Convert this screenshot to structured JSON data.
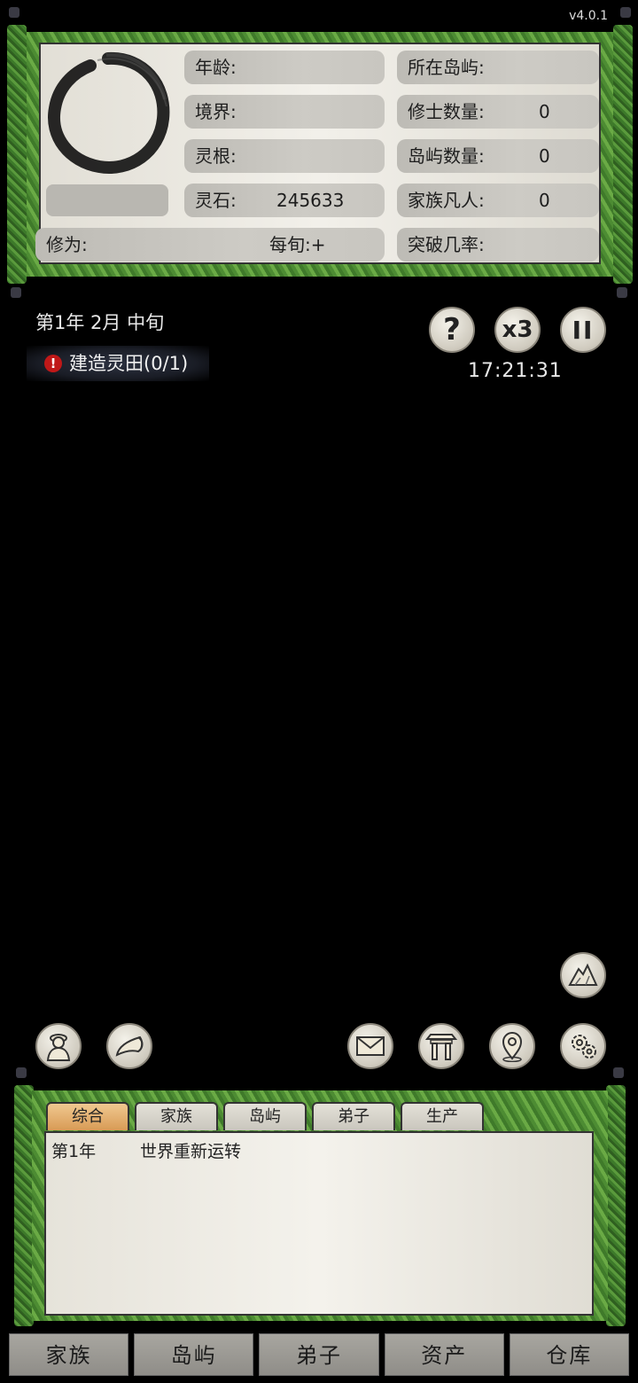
{
  "version": "v4.0.1",
  "profile": {
    "age_label": "年龄:",
    "realm_label": "境界:",
    "root_label": "灵根:",
    "stones_label": "灵石:",
    "stones_value": "245633",
    "cultivation_label": "修为:",
    "per_period_label": "每旬:+",
    "island_label": "所在岛屿:",
    "cultivators_label": "修士数量:",
    "cultivators_value": "0",
    "islands_label": "岛屿数量:",
    "islands_value": "0",
    "mortals_label": "家族凡人:",
    "mortals_value": "0",
    "breakthrough_label": "突破几率:"
  },
  "game_date": "第1年 2月 中旬",
  "task": {
    "alert": "!",
    "text": "建造灵田(0/1)"
  },
  "controls": {
    "help_glyph": "?",
    "speed_label": "x3",
    "pause_glyph": "II"
  },
  "clock": "17:21:31",
  "log_tabs": [
    "综合",
    "家族",
    "岛屿",
    "弟子",
    "生产"
  ],
  "log_entries": [
    {
      "year": "第1年",
      "text": "世界重新运转"
    }
  ],
  "nav": [
    "家族",
    "岛屿",
    "弟子",
    "资产",
    "仓库"
  ],
  "icons": {
    "character": "character-icon",
    "horn": "horn-icon",
    "mail": "mail-icon",
    "shrine": "shrine-icon",
    "map_pin": "map-pin-icon",
    "settings": "gear-icon",
    "mountain": "mountain-icon"
  },
  "colors": {
    "frame_green": "#5a9a3c",
    "active_tab": "#d89b55",
    "alert_red": "#c01818"
  }
}
